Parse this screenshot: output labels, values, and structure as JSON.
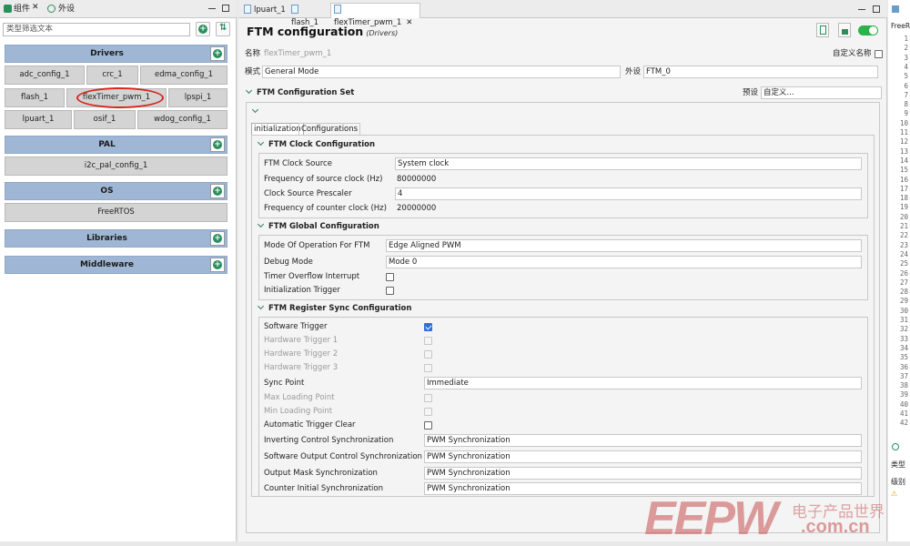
{
  "left_panel": {
    "tab_components": "组件",
    "tab_peripherals": "外设",
    "filter_placeholder": "类型筛选文本",
    "categories": {
      "drivers": "Drivers",
      "pal": "PAL",
      "os": "OS",
      "libraries": "Libraries",
      "middleware": "Middleware"
    },
    "drivers": [
      "adc_config_1",
      "crc_1",
      "edma_config_1",
      "flash_1",
      "flexTimer_pwm_1",
      "lpspi_1",
      "lpuart_1",
      "osif_1",
      "wdog_config_1"
    ],
    "pal": [
      "i2c_pal_config_1"
    ],
    "os": [
      "FreeRTOS"
    ]
  },
  "editor": {
    "tabs": [
      "lpuart_1",
      "flash_1",
      "flexTimer_pwm_1"
    ],
    "title": "FTM configuration",
    "subtitle": "(Drivers)",
    "name_label": "名称",
    "name_value": "flexTimer_pwm_1",
    "custom_name_label": "自定义名称",
    "mode_label": "模式",
    "mode_value": "General Mode",
    "peripheral_label": "外设",
    "peripheral_value": "FTM_0",
    "config_set_title": "FTM Configuration Set",
    "preset_label": "预设",
    "preset_value": "自定义...",
    "inner_tabs": [
      "initialization",
      "Configurations"
    ],
    "clock": {
      "title": "FTM Clock Configuration",
      "source_label": "FTM Clock Source",
      "source_value": "System clock",
      "freq_src_label": "Frequency of source clock (Hz)",
      "freq_src_value": "80000000",
      "prescaler_label": "Clock Source Prescaler",
      "prescaler_value": "4",
      "freq_cnt_label": "Frequency of counter clock (Hz)",
      "freq_cnt_value": "20000000"
    },
    "global": {
      "title": "FTM Global Configuration",
      "mode_label": "Mode Of Operation For FTM",
      "mode_value": "Edge Aligned PWM",
      "debug_label": "Debug Mode",
      "debug_value": "Mode 0",
      "overflow_label": "Timer Overflow Interrupt",
      "init_trigger_label": "Initialization Trigger"
    },
    "sync": {
      "title": "FTM Register Sync Configuration",
      "sw_trigger": "Software Trigger",
      "hw_trigger1": "Hardware Trigger 1",
      "hw_trigger2": "Hardware Trigger 2",
      "hw_trigger3": "Hardware Trigger 3",
      "sync_point_label": "Sync Point",
      "sync_point_value": "Immediate",
      "max_loading": "Max Loading Point",
      "min_loading": "Min Loading Point",
      "auto_clear": "Automatic Trigger Clear",
      "inverting_label": "Inverting Control Synchronization",
      "inverting_value": "PWM Synchronization",
      "sw_output_label": "Software Output Control Synchronization",
      "sw_output_value": "PWM Synchronization",
      "output_mask_label": "Output Mask Synchronization",
      "output_mask_value": "PWM Synchronization",
      "counter_init_label": "Counter Initial Synchronization",
      "counter_init_value": "PWM Synchronization"
    }
  },
  "right_panel": {
    "label": "FreeR",
    "lines": [
      "1",
      "2",
      "3",
      "4",
      "5",
      "6",
      "7",
      "8",
      "9",
      "10",
      "11",
      "12",
      "13",
      "14",
      "15",
      "16",
      "17",
      "18",
      "19",
      "20",
      "21",
      "22",
      "23",
      "24",
      "25",
      "26",
      "27",
      "28",
      "29",
      "30",
      "31",
      "32",
      "33",
      "34",
      "35",
      "36",
      "37",
      "38",
      "39",
      "40",
      "41",
      "42"
    ],
    "bottom_label1": "类型",
    "bottom_label2": "级别"
  },
  "watermark": {
    "logo": "EEPW",
    "cn": "电子产品世界",
    "url": ".com.cn"
  },
  "colors": {
    "category_bg": "#9fb7d4",
    "add_icon": "#2a8f5c",
    "toggle_on": "#2bb34a",
    "checkbox_on": "#2f6fd6",
    "highlight_ellipse": "#d9261c"
  }
}
